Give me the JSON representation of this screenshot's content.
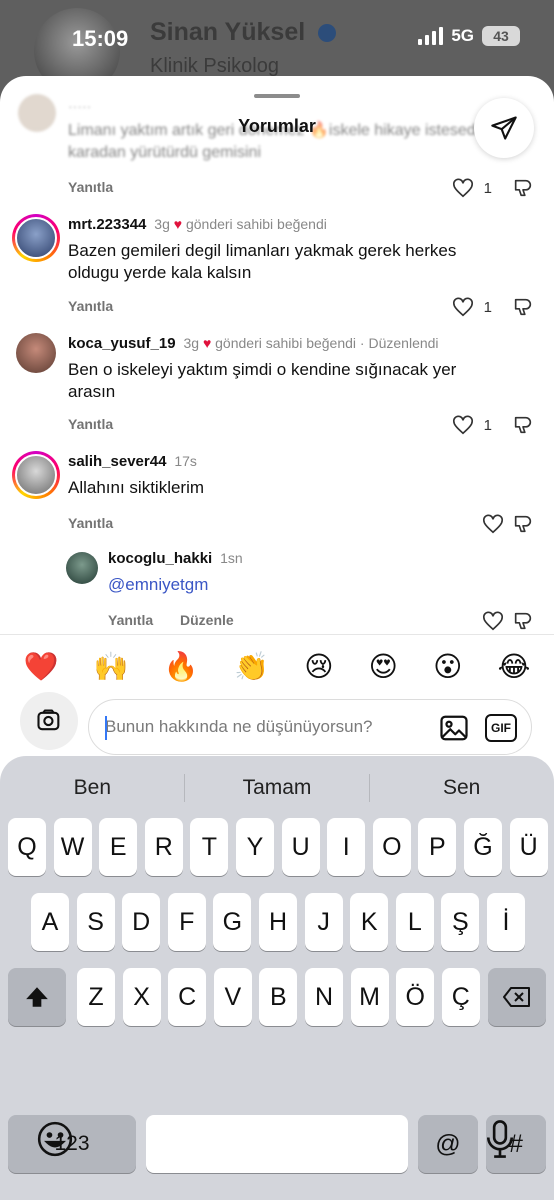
{
  "background_profile": {
    "name": "Sinan Yüksel",
    "subtitle": "Klinik Psikolog"
  },
  "status_bar": {
    "time": "15:09",
    "network": "5G",
    "battery": "43"
  },
  "sheet": {
    "title": "Yorumlar",
    "share_icon": "paper-plane-icon"
  },
  "partial_comment": {
    "text": "Limanı yaktım artık geri dönemez 🔥iskele hikaye istesede karadan yürütürdü gemisini",
    "reply_label": "Yanıtla",
    "like_count": "1"
  },
  "comments": [
    {
      "username": "mrt.223344",
      "time": "3g",
      "owner_liked": "gönderi sahibi beğendi",
      "edited": "",
      "text": "Bazen gemileri degil limanları yakmak gerek herkes oldugu yerde kala kalsın",
      "reply_label": "Yanıtla",
      "like_count": "1"
    },
    {
      "username": "koca_yusuf_19",
      "time": "3g",
      "owner_liked": "gönderi sahibi beğendi",
      "edited": "Düzenlendi",
      "text": "Ben o iskeleyi  yaktım şimdi o kendine sığınacak yer arasın",
      "reply_label": "Yanıtla",
      "like_count": "1"
    },
    {
      "username": "salih_sever44",
      "time": "17s",
      "text": "Allahını siktiklerim",
      "reply_label": "Yanıtla",
      "like_count": ""
    }
  ],
  "reply": {
    "username": "kocoglu_hakki",
    "time": "1sn",
    "text": "@emniyetgm",
    "reply_label": "Yanıtla",
    "edit_label": "Düzenle"
  },
  "quick_emojis": [
    "❤️",
    "🙌",
    "🔥",
    "👏",
    "😢",
    "😍",
    "😮",
    "😂"
  ],
  "composer": {
    "placeholder": "Bunun hakkında ne düşünüyorsun?",
    "gif_label": "GIF"
  },
  "keyboard": {
    "suggestions": [
      "Ben",
      "Tamam",
      "Sen"
    ],
    "row1": [
      "Q",
      "W",
      "E",
      "R",
      "T",
      "Y",
      "U",
      "I",
      "O",
      "P",
      "Ğ",
      "Ü"
    ],
    "row2": [
      "A",
      "S",
      "D",
      "F",
      "G",
      "H",
      "J",
      "K",
      "L",
      "Ş",
      "İ"
    ],
    "row3": [
      "Z",
      "X",
      "C",
      "V",
      "B",
      "N",
      "M",
      "Ö",
      "Ç"
    ],
    "numbers_key": "123",
    "at_key": "@",
    "hash_key": "#"
  },
  "colors": {
    "owner_heart": "#e0123c",
    "mention": "#3a56c5",
    "keyboard_bg": "#d3d5db"
  }
}
